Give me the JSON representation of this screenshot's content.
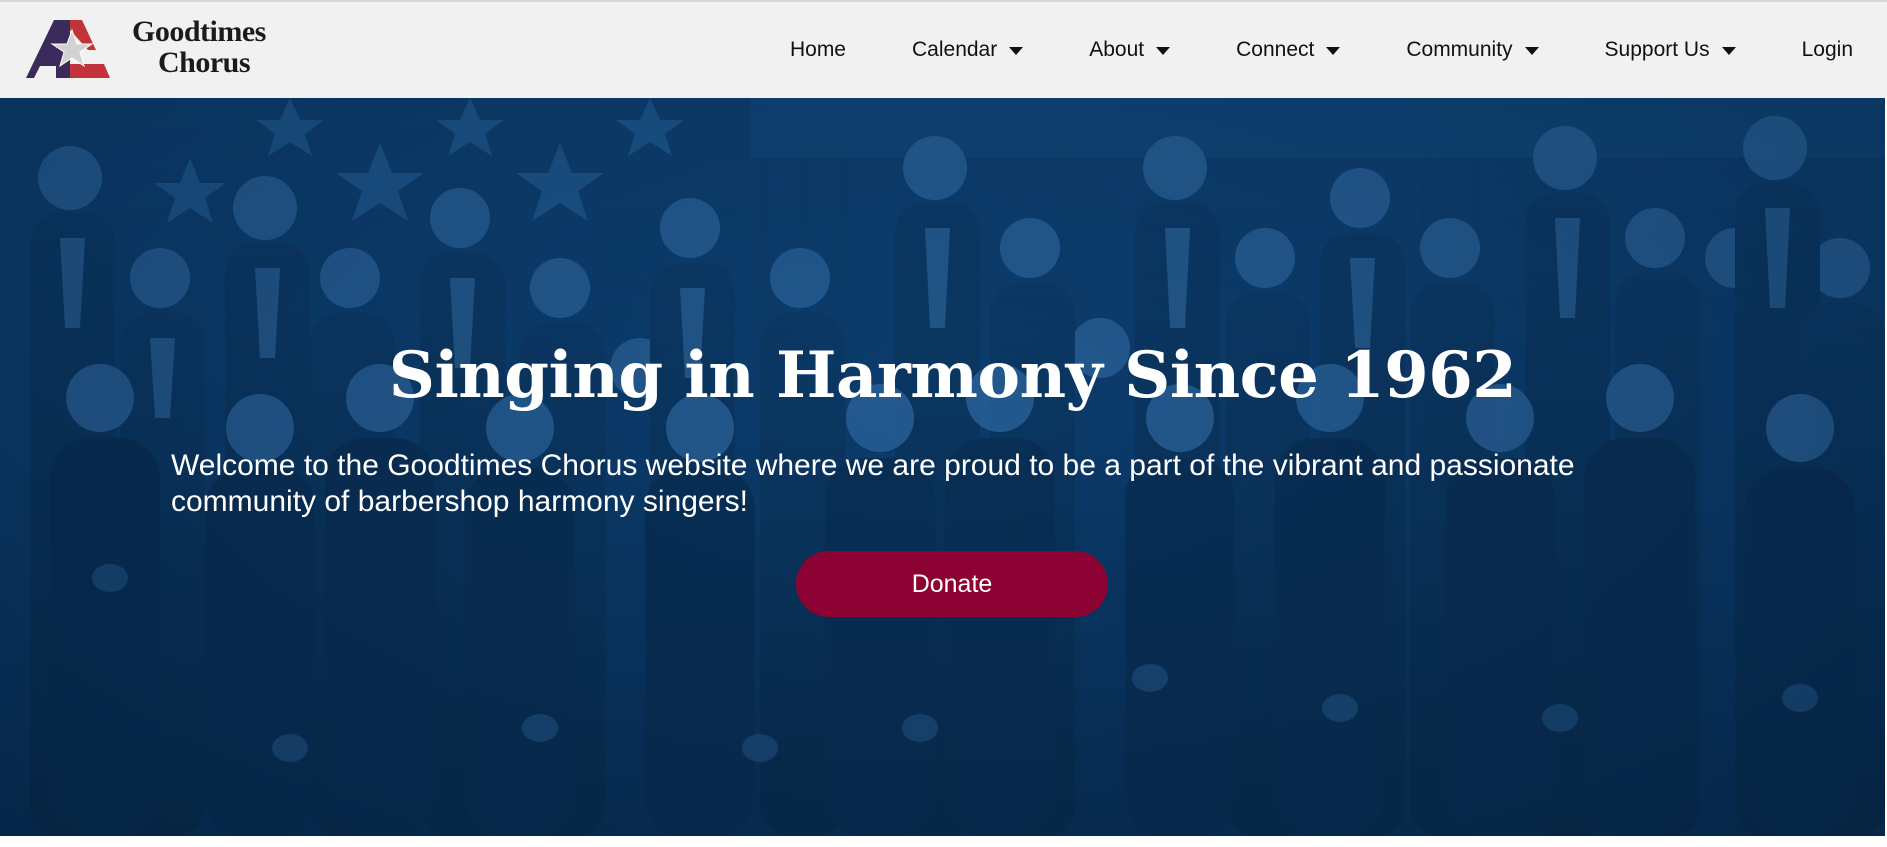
{
  "header": {
    "logo": {
      "line1": "Goodtimes",
      "line2": "Chorus",
      "colors": {
        "purple": "#3b2a5c",
        "red": "#c0343a",
        "star": "#c8c8c8"
      }
    },
    "nav": [
      {
        "label": "Home",
        "has_dropdown": false
      },
      {
        "label": "Calendar",
        "has_dropdown": true
      },
      {
        "label": "About",
        "has_dropdown": true
      },
      {
        "label": "Connect",
        "has_dropdown": true
      },
      {
        "label": "Community",
        "has_dropdown": true
      },
      {
        "label": "Support Us",
        "has_dropdown": true
      },
      {
        "label": "Login",
        "has_dropdown": false
      }
    ]
  },
  "hero": {
    "title": "Singing in Harmony Since 1962",
    "text": "Welcome to the Goodtimes Chorus website where we are proud to be a part of the vibrant and passionate community of barbershop harmony singers!",
    "donate_label": "Donate",
    "colors": {
      "overlay": "#0a3866",
      "button": "#8c0333"
    }
  }
}
